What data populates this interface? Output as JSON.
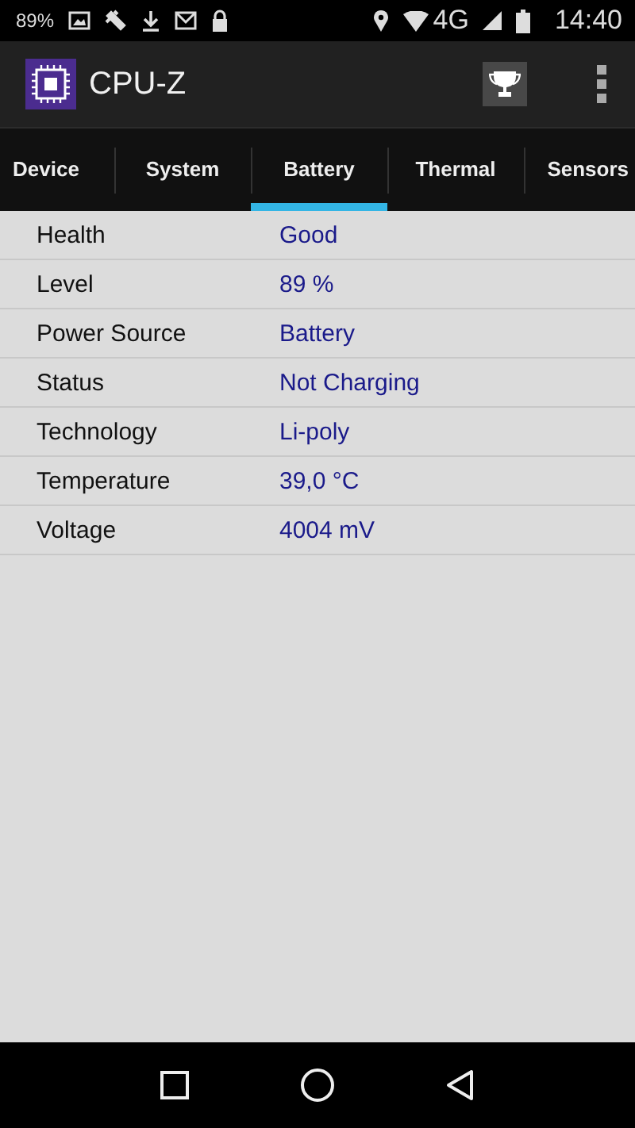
{
  "status_bar": {
    "battery_percent": "89%",
    "network": "4G",
    "time": "14:40"
  },
  "app_bar": {
    "title": "CPU-Z"
  },
  "tabs": [
    {
      "label": "Device",
      "selected": false
    },
    {
      "label": "System",
      "selected": false
    },
    {
      "label": "Battery",
      "selected": true
    },
    {
      "label": "Thermal",
      "selected": false
    },
    {
      "label": "Sensors",
      "selected": false
    }
  ],
  "rows": [
    {
      "label": "Health",
      "value": "Good"
    },
    {
      "label": "Level",
      "value": "89 %"
    },
    {
      "label": "Power Source",
      "value": "Battery"
    },
    {
      "label": "Status",
      "value": "Not Charging"
    },
    {
      "label": "Technology",
      "value": "Li-poly"
    },
    {
      "label": "Temperature",
      "value": "39,0 °C"
    },
    {
      "label": "Voltage",
      "value": "4004 mV"
    }
  ]
}
